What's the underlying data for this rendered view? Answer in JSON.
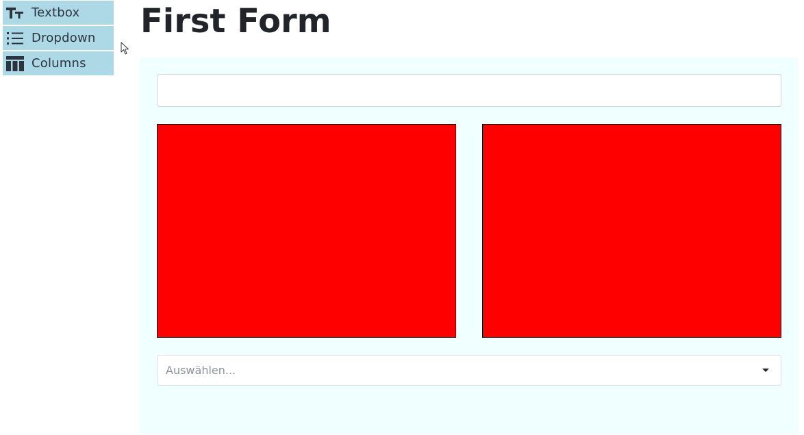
{
  "palette": {
    "items": [
      {
        "label": "Textbox",
        "icon": "text-height-icon"
      },
      {
        "label": "Dropdown",
        "icon": "list-icon"
      },
      {
        "label": "Columns",
        "icon": "table-columns-icon"
      }
    ],
    "background_color": "#add8e6"
  },
  "form": {
    "title": "First Form",
    "canvas_color": "#f0ffff",
    "textbox": {
      "value": "",
      "placeholder": ""
    },
    "columns": {
      "count": 2,
      "color": "#ff0000"
    },
    "dropdown": {
      "placeholder": "Auswählen...",
      "icon": "caret-down-icon"
    }
  },
  "cursor": {
    "icon": "mouse-pointer-icon"
  }
}
